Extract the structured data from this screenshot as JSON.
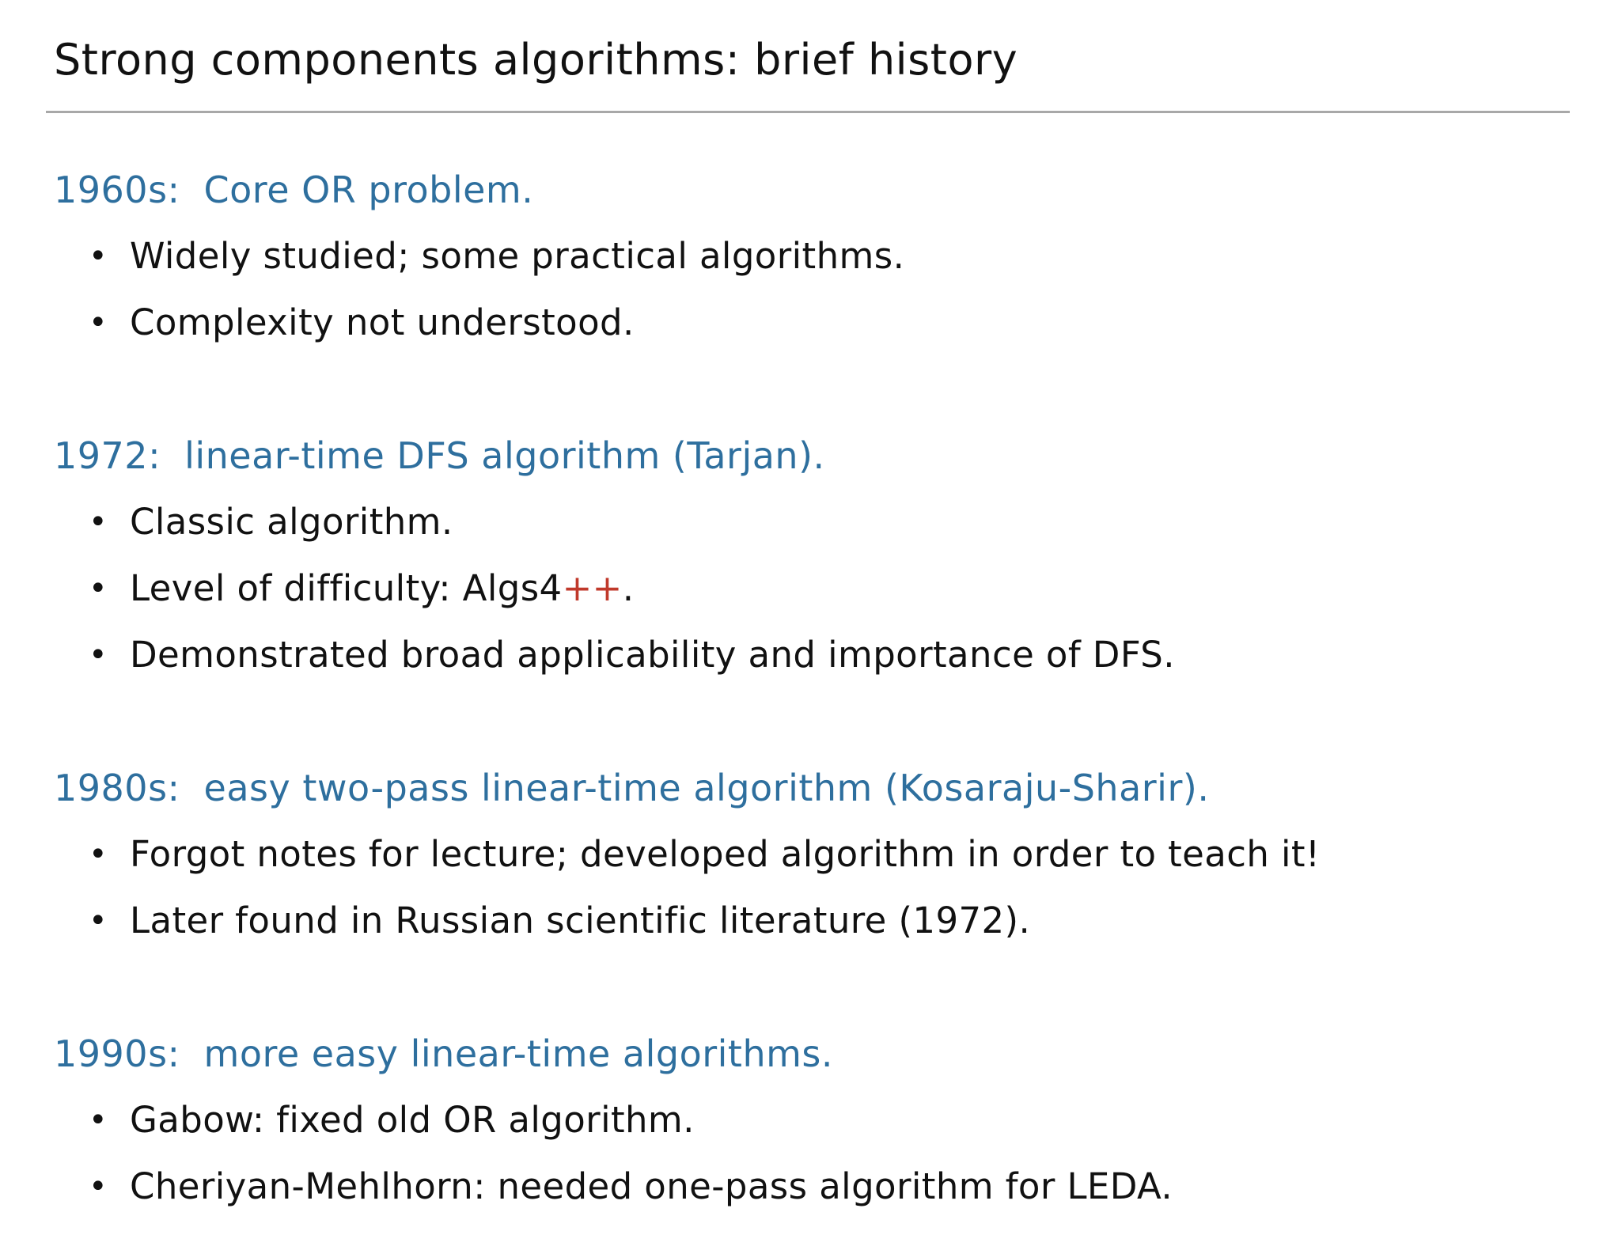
{
  "slide": {
    "title": "Strong components algorithms:  brief history",
    "sections": [
      {
        "year": "1960s:",
        "heading": "Core OR problem.",
        "bullets": [
          "Widely studied; some practical algorithms.",
          "Complexity not understood."
        ]
      },
      {
        "year": "1972:",
        "heading": "linear-time DFS algorithm (Tarjan).",
        "bullets": [
          "Classic algorithm.",
          "Level of difficulty: Algs4++.",
          "Demonstrated broad applicability and importance of DFS."
        ],
        "difficulty_prefix": "Level of difficulty: Algs4",
        "difficulty_plus": "++",
        "difficulty_suffix": "."
      },
      {
        "year": "1980s:",
        "heading": "easy two-pass linear-time algorithm (Kosaraju-Sharir).",
        "bullets": [
          "Forgot notes for lecture; developed algorithm in order to teach it!",
          "Later found in Russian scientific literature (1972)."
        ]
      },
      {
        "year": "1990s:",
        "heading": "more easy linear-time algorithms.",
        "bullets": [
          "Gabow: fixed old OR algorithm.",
          "Cheriyan-Mehlhorn: needed one-pass algorithm for LEDA."
        ]
      }
    ],
    "bullet_glyph": "•",
    "colors": {
      "heading": "#2e6f9e",
      "text": "#111111",
      "rule": "#a8a8a8",
      "highlight": "#c0392b"
    }
  }
}
